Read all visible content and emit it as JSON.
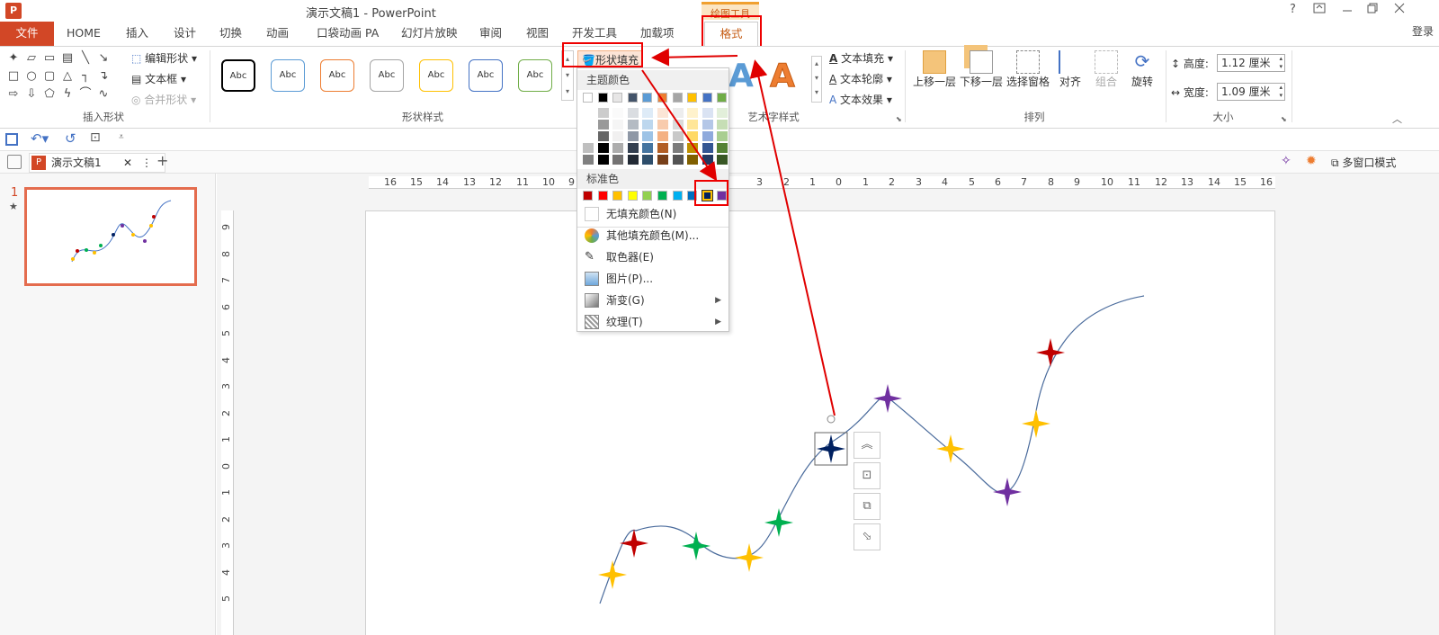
{
  "window": {
    "title": "演示文稿1 - PowerPoint",
    "app_icon": "P",
    "context_tab_group": "绘图工具",
    "help": "?",
    "controls": [
      "restore-ribbon-icon",
      "minimize-icon",
      "maximize-icon",
      "close-icon"
    ],
    "login": "登录"
  },
  "tabs": [
    {
      "label": "文件"
    },
    {
      "label": "HOME"
    },
    {
      "label": "插入"
    },
    {
      "label": "设计"
    },
    {
      "label": "切换"
    },
    {
      "label": "动画"
    },
    {
      "label": "口袋动画 PA"
    },
    {
      "label": "幻灯片放映"
    },
    {
      "label": "审阅"
    },
    {
      "label": "视图"
    },
    {
      "label": "开发工具"
    },
    {
      "label": "加载项"
    },
    {
      "label": "格式"
    }
  ],
  "ribbon": {
    "insert_shapes": {
      "label": "插入形状",
      "edit_shape": "编辑形状",
      "text_box": "文本框",
      "merge_shapes": "合并形状"
    },
    "shape_styles": {
      "label": "形状样式",
      "chip_text": "Abc",
      "chip_colors": [
        "#000000",
        "#5b9bd5",
        "#ed7d31",
        "#a5a5a5",
        "#ffc000",
        "#4472c4",
        "#70ad47"
      ],
      "fill_button": "形状填充"
    },
    "wordart": {
      "label": "艺术字样式",
      "text_fill": "文本填充",
      "text_outline": "文本轮廓",
      "text_effects": "文本效果"
    },
    "arrange": {
      "label": "排列",
      "bring_forward": "上移一层",
      "send_backward": "下移一层",
      "selection_pane": "选择窗格",
      "align": "对齐",
      "group": "组合",
      "rotate": "旋转"
    },
    "size": {
      "label": "大小",
      "height_label": "高度:",
      "height_value": "1.12 厘米",
      "width_label": "宽度:",
      "width_value": "1.09 厘米"
    }
  },
  "doc_tab": {
    "name": "演示文稿1",
    "multi_window": "多窗口模式"
  },
  "slides_panel": {
    "slide_number": "1",
    "star": "★"
  },
  "rulers": {
    "horizontal": [
      "16",
      "15",
      "14",
      "13",
      "12",
      "11",
      "10",
      "9",
      "3",
      "2",
      "1",
      "0",
      "1",
      "2",
      "3",
      "4",
      "5",
      "6",
      "7",
      "8",
      "9",
      "10",
      "11",
      "12",
      "13",
      "14",
      "15",
      "16"
    ],
    "vertical": [
      "9",
      "8",
      "7",
      "6",
      "5",
      "4",
      "3",
      "2",
      "1",
      "0",
      "1",
      "2",
      "3",
      "4",
      "5"
    ]
  },
  "fill_dropdown": {
    "theme_colors_header": "主题颜色",
    "theme_top_row": [
      "#ffffff",
      "#000000",
      "#e7e6e6",
      "#44546a",
      "#5b9bd5",
      "#ed7d31",
      "#a5a5a5",
      "#ffc000",
      "#4472c4",
      "#70ad47"
    ],
    "standard_colors_header": "标准色",
    "standard_colors": [
      "#c00000",
      "#ff0000",
      "#ffc000",
      "#ffff00",
      "#92d050",
      "#00b050",
      "#00b0f0",
      "#0070c0",
      "#002060",
      "#7030a0"
    ],
    "no_fill": "无填充颜色(N)",
    "more_colors": "其他填充颜色(M)...",
    "eyedropper": "取色器(E)",
    "picture": "图片(P)...",
    "gradient": "渐变(G)",
    "texture": "纹理(T)"
  },
  "colors": {
    "accent": "#d24726",
    "context": "#c55a11",
    "annotation_red": "#e00000"
  }
}
